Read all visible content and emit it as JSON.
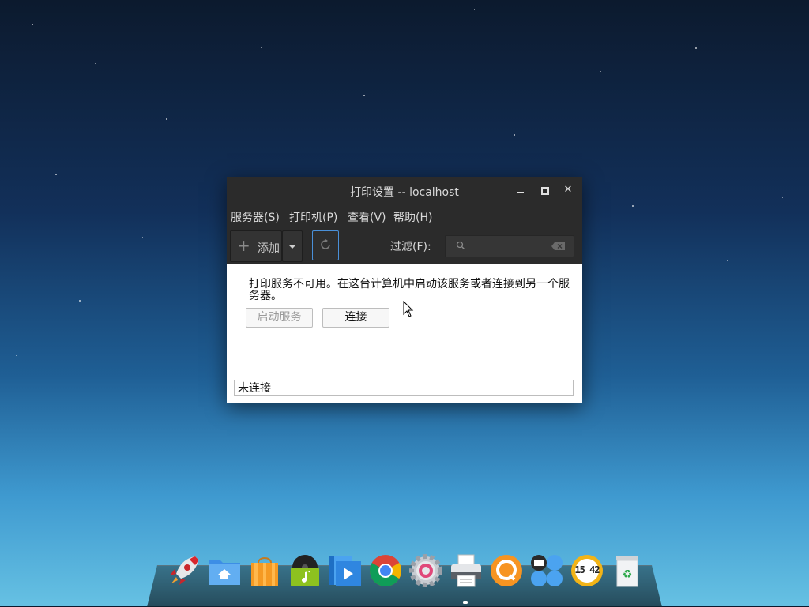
{
  "window": {
    "title": "打印设置 -- localhost",
    "menu": [
      "服务器(S)",
      "打印机(P)",
      "查看(V)",
      "帮助(H)"
    ],
    "toolbar": {
      "add_label": "添加",
      "filter_label": "过滤(F):",
      "filter_value": ""
    },
    "message": "打印服务不可用。在这台计算机中启动该服务或者连接到另一个服务器。",
    "buttons": {
      "start_service": "启动服务",
      "connect": "连接"
    },
    "status": "未连接"
  },
  "dock": {
    "icons": [
      "launcher-rocket-icon",
      "file-manager-icon",
      "app-store-icon",
      "music-player-icon",
      "video-player-icon",
      "chrome-browser-icon",
      "settings-icon",
      "printer-icon",
      "browser-q-icon",
      "input-method-icon",
      "clock-icon",
      "trash-icon"
    ],
    "clock_text": "15 42"
  },
  "colors": {
    "titlebar": "#2b2b2b",
    "accent": "#4a90d9"
  }
}
